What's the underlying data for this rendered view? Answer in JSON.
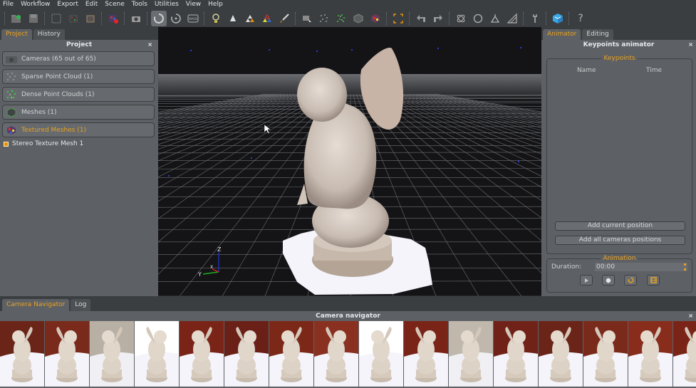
{
  "menu": [
    "File",
    "Workflow",
    "Export",
    "Edit",
    "Scene",
    "Tools",
    "Utilities",
    "View",
    "Help"
  ],
  "toolbar": {
    "icons": [
      "new-project-icon",
      "save-icon",
      "image-grid-icon",
      "point-cube-icon",
      "mesh-cube-icon",
      "textured-cube-icon",
      "camera-icon",
      "orbit-icon",
      "rotate-icon",
      "wasd-icon",
      "light-bulb-icon",
      "triangles-icon",
      "triangles-orange-icon",
      "triangles-rgb-icon",
      "brush-icon",
      "camera-select-icon",
      "sparse-points-icon",
      "dense-points-icon",
      "mesh-box-icon",
      "texture-box-icon",
      "bounding-box-icon",
      "undo-icon",
      "redo-icon",
      "atom-icon",
      "circle-icon",
      "gizmo-icon",
      "ruler-icon",
      "wrench-icon",
      "cube-logo-icon",
      "help-icon"
    ],
    "active": "orbit-icon",
    "wasd_label": "WASD",
    "help_label": "?"
  },
  "left_panel": {
    "tabs": [
      {
        "label": "Project",
        "active": true
      },
      {
        "label": "History",
        "active": false
      }
    ],
    "title": "Project",
    "close": "×",
    "items": [
      {
        "label": "Cameras (65 out of 65)",
        "icon": "camera-icon",
        "active": false
      },
      {
        "label": "Sparse Point Cloud (1)",
        "icon": "sparse-points-icon",
        "active": false
      },
      {
        "label": "Dense Point Clouds (1)",
        "icon": "dense-points-icon",
        "active": false
      },
      {
        "label": "Meshes (1)",
        "icon": "mesh-icon",
        "active": false
      },
      {
        "label": "Textured Meshes (1)",
        "icon": "textured-mesh-icon",
        "active": true
      }
    ],
    "tree": [
      {
        "label": "Stereo Texture Mesh 1",
        "checked": true
      }
    ]
  },
  "viewport": {
    "axes": {
      "x": "X",
      "y": "Y",
      "z": "Z"
    }
  },
  "right_panel": {
    "tabs": [
      {
        "label": "Animator",
        "active": true
      },
      {
        "label": "Editing",
        "active": false
      }
    ],
    "title": "Keypoints animator",
    "close": "×",
    "keypoints": {
      "title": "Keypoints",
      "columns": [
        "Name",
        "Time"
      ],
      "rows": [],
      "add_current": "Add current position",
      "add_all": "Add all cameras positions"
    },
    "animation": {
      "title": "Animation",
      "duration_label": "Duration:",
      "duration_value": "00:00",
      "buttons": [
        "play-icon",
        "record-icon",
        "loop-icon",
        "film-icon"
      ]
    }
  },
  "bottom": {
    "tabs": [
      {
        "label": "Camera Navigator",
        "active": true
      },
      {
        "label": "Log",
        "active": false
      }
    ],
    "title": "Camera navigator",
    "close": "×",
    "thumbnail_count_visible": 16
  },
  "colors": {
    "accent": "#e8a020",
    "panel": "#5d6165",
    "viewport": "#141417"
  }
}
